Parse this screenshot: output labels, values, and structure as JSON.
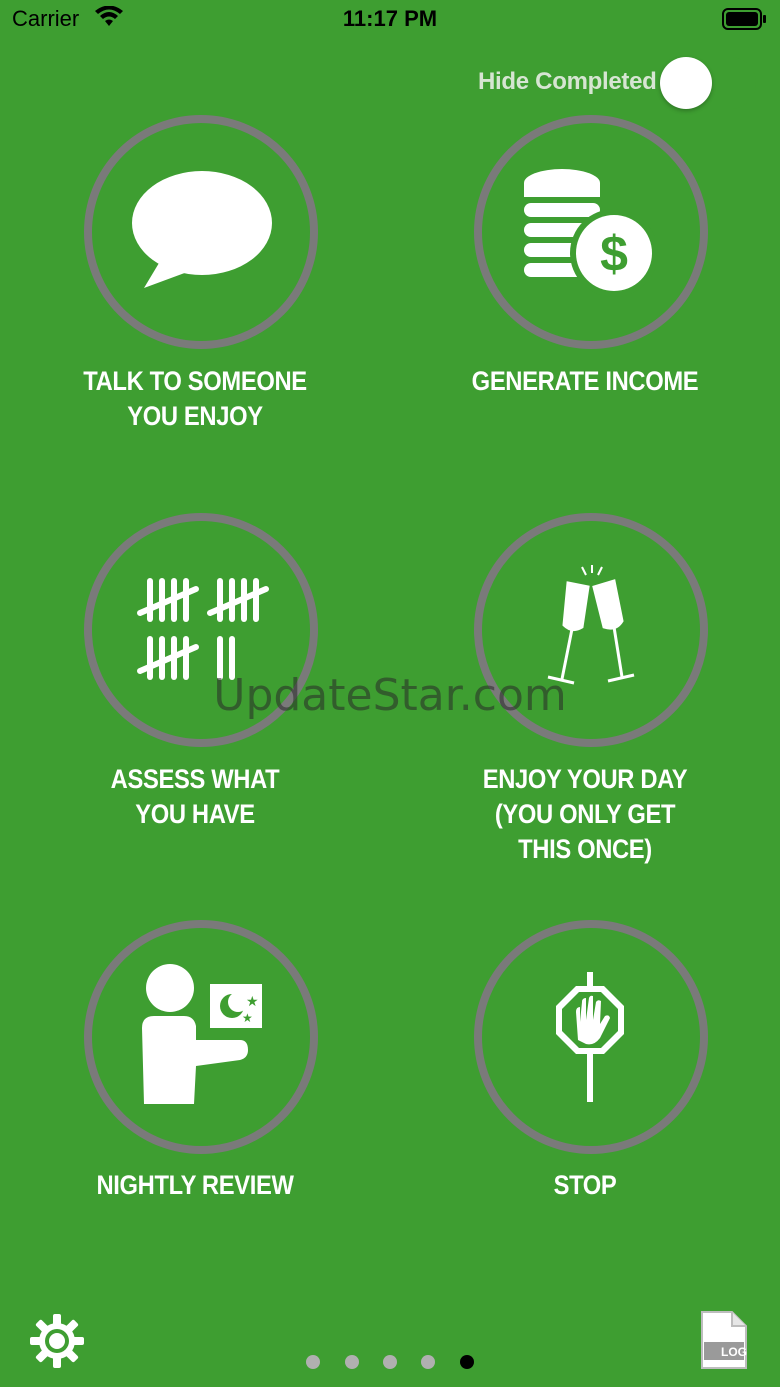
{
  "status": {
    "carrier": "Carrier",
    "time": "11:17 PM"
  },
  "toggle": {
    "label": "Hide Completed",
    "on": false
  },
  "tiles": [
    {
      "lines": [
        "TALK TO SOMEONE",
        "YOU ENJOY"
      ],
      "icon": "speech-bubble-icon"
    },
    {
      "lines": [
        "GENERATE INCOME"
      ],
      "icon": "coins-dollar-icon"
    },
    {
      "lines": [
        "ASSESS WHAT",
        "YOU HAVE"
      ],
      "icon": "tally-marks-icon"
    },
    {
      "lines": [
        "ENJOY YOUR DAY",
        "(YOU ONLY GET",
        "THIS ONCE)"
      ],
      "icon": "champagne-toast-icon"
    },
    {
      "lines": [
        "NIGHTLY REVIEW"
      ],
      "icon": "person-night-sign-icon"
    },
    {
      "lines": [
        "STOP"
      ],
      "icon": "stop-sign-hand-icon"
    }
  ],
  "watermark": "UpdateStar.com",
  "footer": {
    "log_label": "LOG",
    "pages": 5,
    "current_page": 5
  },
  "colors": {
    "background": "#3e9e31",
    "ring": "#7a7a7a",
    "text": "#ffffff"
  }
}
